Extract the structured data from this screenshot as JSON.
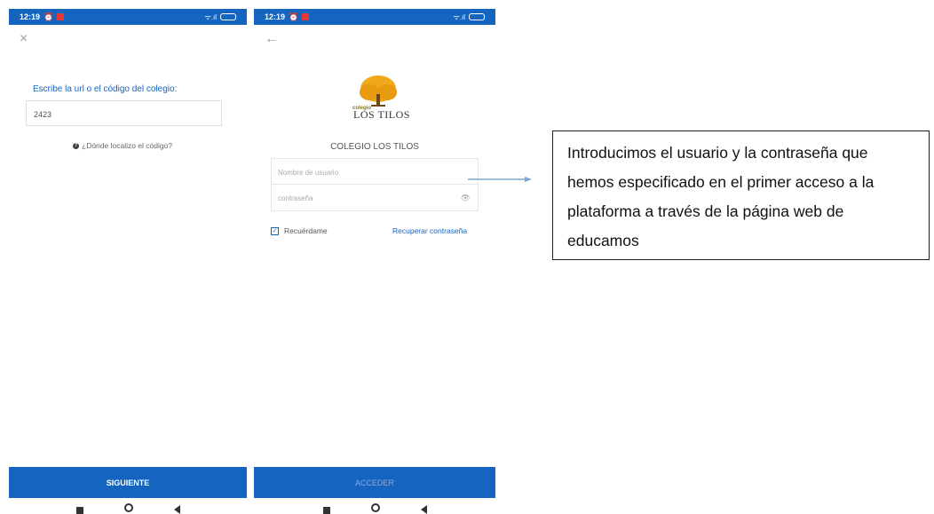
{
  "phone1": {
    "status": {
      "time": "12:19",
      "right": "ᯤ.ıl"
    },
    "close_icon": "×",
    "label": "Escribe la url o el código del colegio:",
    "code_value": "2423",
    "help_text": "¿Dónde localizo el código?",
    "next_button": "SIGUIENTE"
  },
  "phone2": {
    "status": {
      "time": "12:19",
      "right": "ᯤ.ıl"
    },
    "back_icon": "←",
    "logo_small": "colegio",
    "logo_name": "LOS TILOS",
    "school_name": "COLEGIO LOS TILOS",
    "username_placeholder": "Nombre de usuario",
    "password_placeholder": "contraseña",
    "remember_label": "Recuérdame",
    "recover_link": "Recuperar contraseña",
    "login_button": "ACCEDER"
  },
  "callout": {
    "text": "Introducimos el usuario y la contraseña que hemos especificado en el primer acceso a la plataforma a través de la página web de educamos"
  },
  "colors": {
    "primary": "#1565c0",
    "logo_tree": "#f0a81c"
  }
}
